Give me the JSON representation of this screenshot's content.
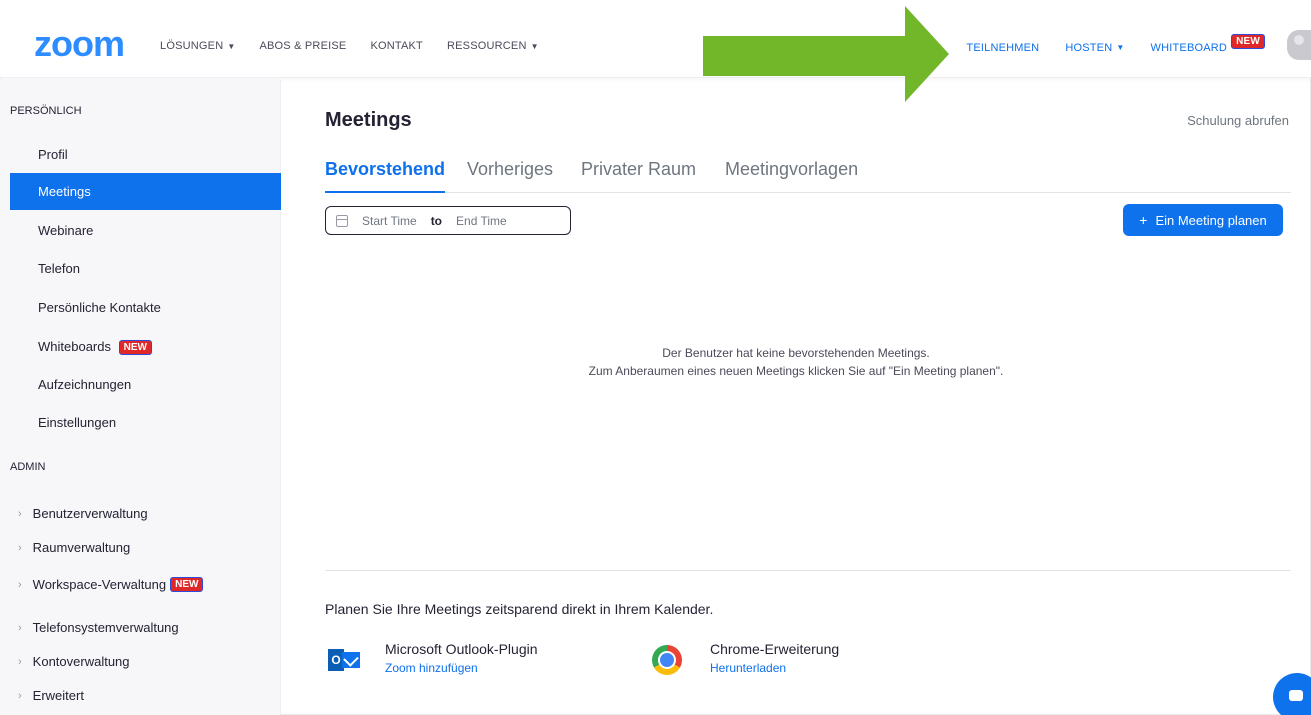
{
  "brand": {
    "logo": "zoom",
    "accent": "#0e72ed",
    "logo_color": "#2d8cff"
  },
  "topnav": {
    "left": [
      {
        "label": "LÖSUNGEN",
        "has_caret": true
      },
      {
        "label": "ABOS & PREISE",
        "has_caret": false
      },
      {
        "label": "KONTAKT",
        "has_caret": false
      },
      {
        "label": "RESSOURCEN",
        "has_caret": true
      }
    ],
    "right": [
      {
        "label": "TEILNEHMEN",
        "has_caret": false
      },
      {
        "label": "HOSTEN",
        "has_caret": true
      },
      {
        "label": "WHITEBOARD",
        "badge": "NEW"
      }
    ],
    "arrow_color": "#72b62a"
  },
  "sidebar": {
    "personal_title": "PERSÖNLICH",
    "personal_items": [
      {
        "label": "Profil"
      },
      {
        "label": "Meetings",
        "active": true
      },
      {
        "label": "Webinare"
      },
      {
        "label": "Telefon"
      },
      {
        "label": "Persönliche Kontakte"
      },
      {
        "label": "Whiteboards",
        "badge": "NEW"
      },
      {
        "label": "Aufzeichnungen"
      },
      {
        "label": "Einstellungen"
      }
    ],
    "admin_title": "ADMIN",
    "admin_items": [
      {
        "label": "Benutzerverwaltung"
      },
      {
        "label": "Raumverwaltung"
      },
      {
        "label": "Workspace-Verwaltung",
        "badge": "NEW"
      },
      {
        "label": "Telefonsystemverwaltung"
      },
      {
        "label": "Kontoverwaltung"
      },
      {
        "label": "Erweitert"
      }
    ]
  },
  "main": {
    "title": "Meetings",
    "training_link": "Schulung abrufen",
    "tabs": [
      {
        "label": "Bevorstehend",
        "active": true
      },
      {
        "label": "Vorheriges"
      },
      {
        "label": "Privater Raum"
      },
      {
        "label": "Meetingvorlagen"
      }
    ],
    "date_range": {
      "start_placeholder": "Start Time",
      "to_label": "to",
      "end_placeholder": "End Time"
    },
    "plan_button": "Ein Meeting planen",
    "empty_line1": "Der Benutzer hat keine bevorstehenden Meetings.",
    "empty_line2": "Zum Anberaumen eines neuen Meetings klicken Sie auf \"Ein Meeting planen\".",
    "calendar_text": "Planen Sie Ihre Meetings zeitsparend direkt in Ihrem Kalender.",
    "plugins": [
      {
        "name": "Microsoft Outlook-Plugin",
        "link": "Zoom hinzufügen",
        "icon": "outlook-icon"
      },
      {
        "name": "Chrome-Erweiterung",
        "link": "Herunterladen",
        "icon": "chrome-icon"
      }
    ]
  }
}
